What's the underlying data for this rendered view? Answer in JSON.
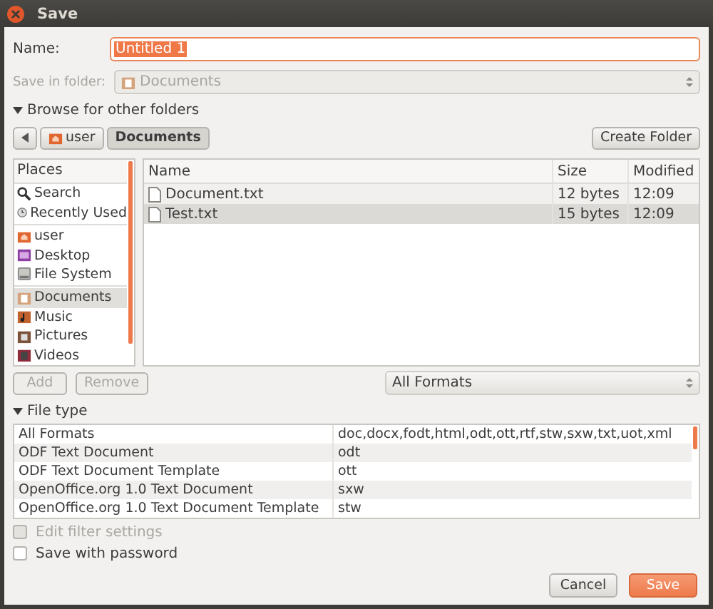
{
  "window": {
    "title": "Save"
  },
  "name_field": {
    "label": "Name:",
    "value": "Untitled 1"
  },
  "save_in_folder": {
    "label": "Save in folder:",
    "value": "Documents",
    "disabled": true
  },
  "browse_expander": {
    "label": "Browse for other folders",
    "expanded": true
  },
  "path_bar": {
    "segments": [
      {
        "label": "user",
        "kind": "home",
        "selected": false
      },
      {
        "label": "Documents",
        "kind": "plain",
        "selected": true
      }
    ],
    "create_folder": "Create Folder"
  },
  "places": {
    "header": "Places",
    "groups": [
      [
        {
          "label": "Search",
          "kind": "search",
          "selected": false
        },
        {
          "label": "Recently Used",
          "kind": "recent",
          "selected": false
        }
      ],
      [
        {
          "label": "user",
          "kind": "home",
          "selected": false
        },
        {
          "label": "Desktop",
          "kind": "desktop",
          "selected": false
        },
        {
          "label": "File System",
          "kind": "drive",
          "selected": false
        }
      ],
      [
        {
          "label": "Documents",
          "kind": "documents",
          "selected": true
        },
        {
          "label": "Music",
          "kind": "music",
          "selected": false
        },
        {
          "label": "Pictures",
          "kind": "pictures",
          "selected": false
        },
        {
          "label": "Videos",
          "kind": "videos",
          "selected": false
        }
      ]
    ]
  },
  "files": {
    "columns": [
      "Name",
      "Size",
      "Modified"
    ],
    "rows": [
      {
        "name": "Document.txt",
        "size": "12 bytes",
        "modified": "12:09",
        "selected": false
      },
      {
        "name": "Test.txt",
        "size": "15 bytes",
        "modified": "12:09",
        "selected": true
      }
    ]
  },
  "place_buttons": [
    {
      "label": "Add",
      "disabled": true
    },
    {
      "label": "Remove",
      "disabled": true
    }
  ],
  "format_combo": {
    "value": "All Formats"
  },
  "file_type_expander": {
    "label": "File type",
    "expanded": true
  },
  "file_types": [
    {
      "name": "All Formats",
      "extensions": "doc,docx,fodt,html,odt,ott,rtf,stw,sxw,txt,uot,xml"
    },
    {
      "name": "ODF Text Document",
      "extensions": "odt"
    },
    {
      "name": "ODF Text Document Template",
      "extensions": "ott"
    },
    {
      "name": "OpenOffice.org 1.0 Text Document",
      "extensions": "sxw"
    },
    {
      "name": "OpenOffice.org 1.0 Text Document Template",
      "extensions": "stw"
    }
  ],
  "options": [
    {
      "label": "Edit filter settings",
      "checked": false,
      "disabled": true
    },
    {
      "label": "Save with password",
      "checked": false,
      "disabled": false
    }
  ],
  "buttons": [
    {
      "label": "Cancel",
      "kind": "secondary"
    },
    {
      "label": "Save",
      "kind": "primary"
    }
  ]
}
